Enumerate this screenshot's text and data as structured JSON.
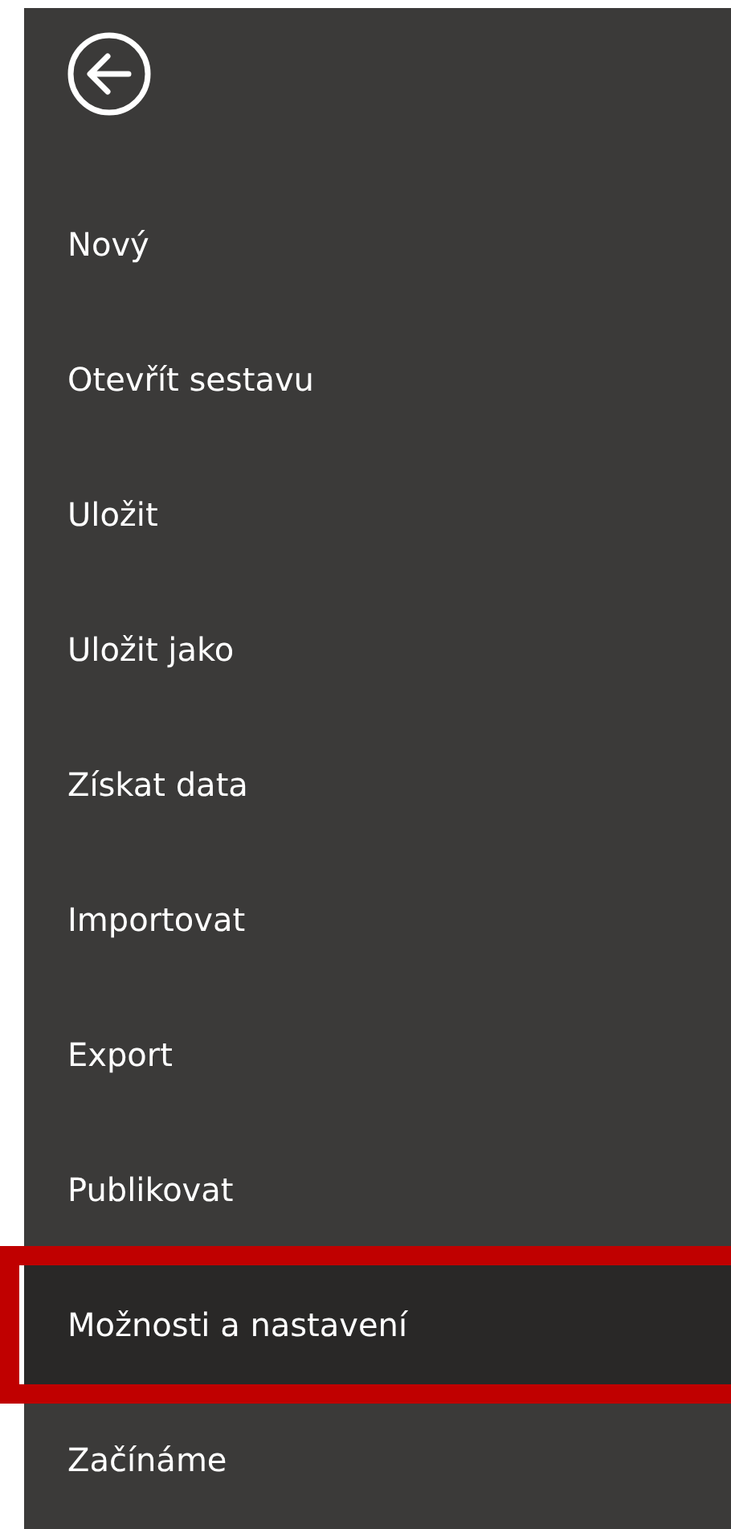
{
  "menu_items": [
    {
      "label": "Nový",
      "selected": false,
      "annotated": false
    },
    {
      "label": "Otevřít sestavu",
      "selected": false,
      "annotated": false
    },
    {
      "label": "Uložit",
      "selected": false,
      "annotated": false
    },
    {
      "label": "Uložit jako",
      "selected": false,
      "annotated": false
    },
    {
      "label": "Získat data",
      "selected": false,
      "annotated": false
    },
    {
      "label": "Importovat",
      "selected": false,
      "annotated": false
    },
    {
      "label": "Export",
      "selected": false,
      "annotated": false
    },
    {
      "label": "Publikovat",
      "selected": false,
      "annotated": false
    },
    {
      "label": "Možnosti a nastavení",
      "selected": true,
      "annotated": true
    },
    {
      "label": "Začínáme",
      "selected": false,
      "annotated": false
    }
  ]
}
